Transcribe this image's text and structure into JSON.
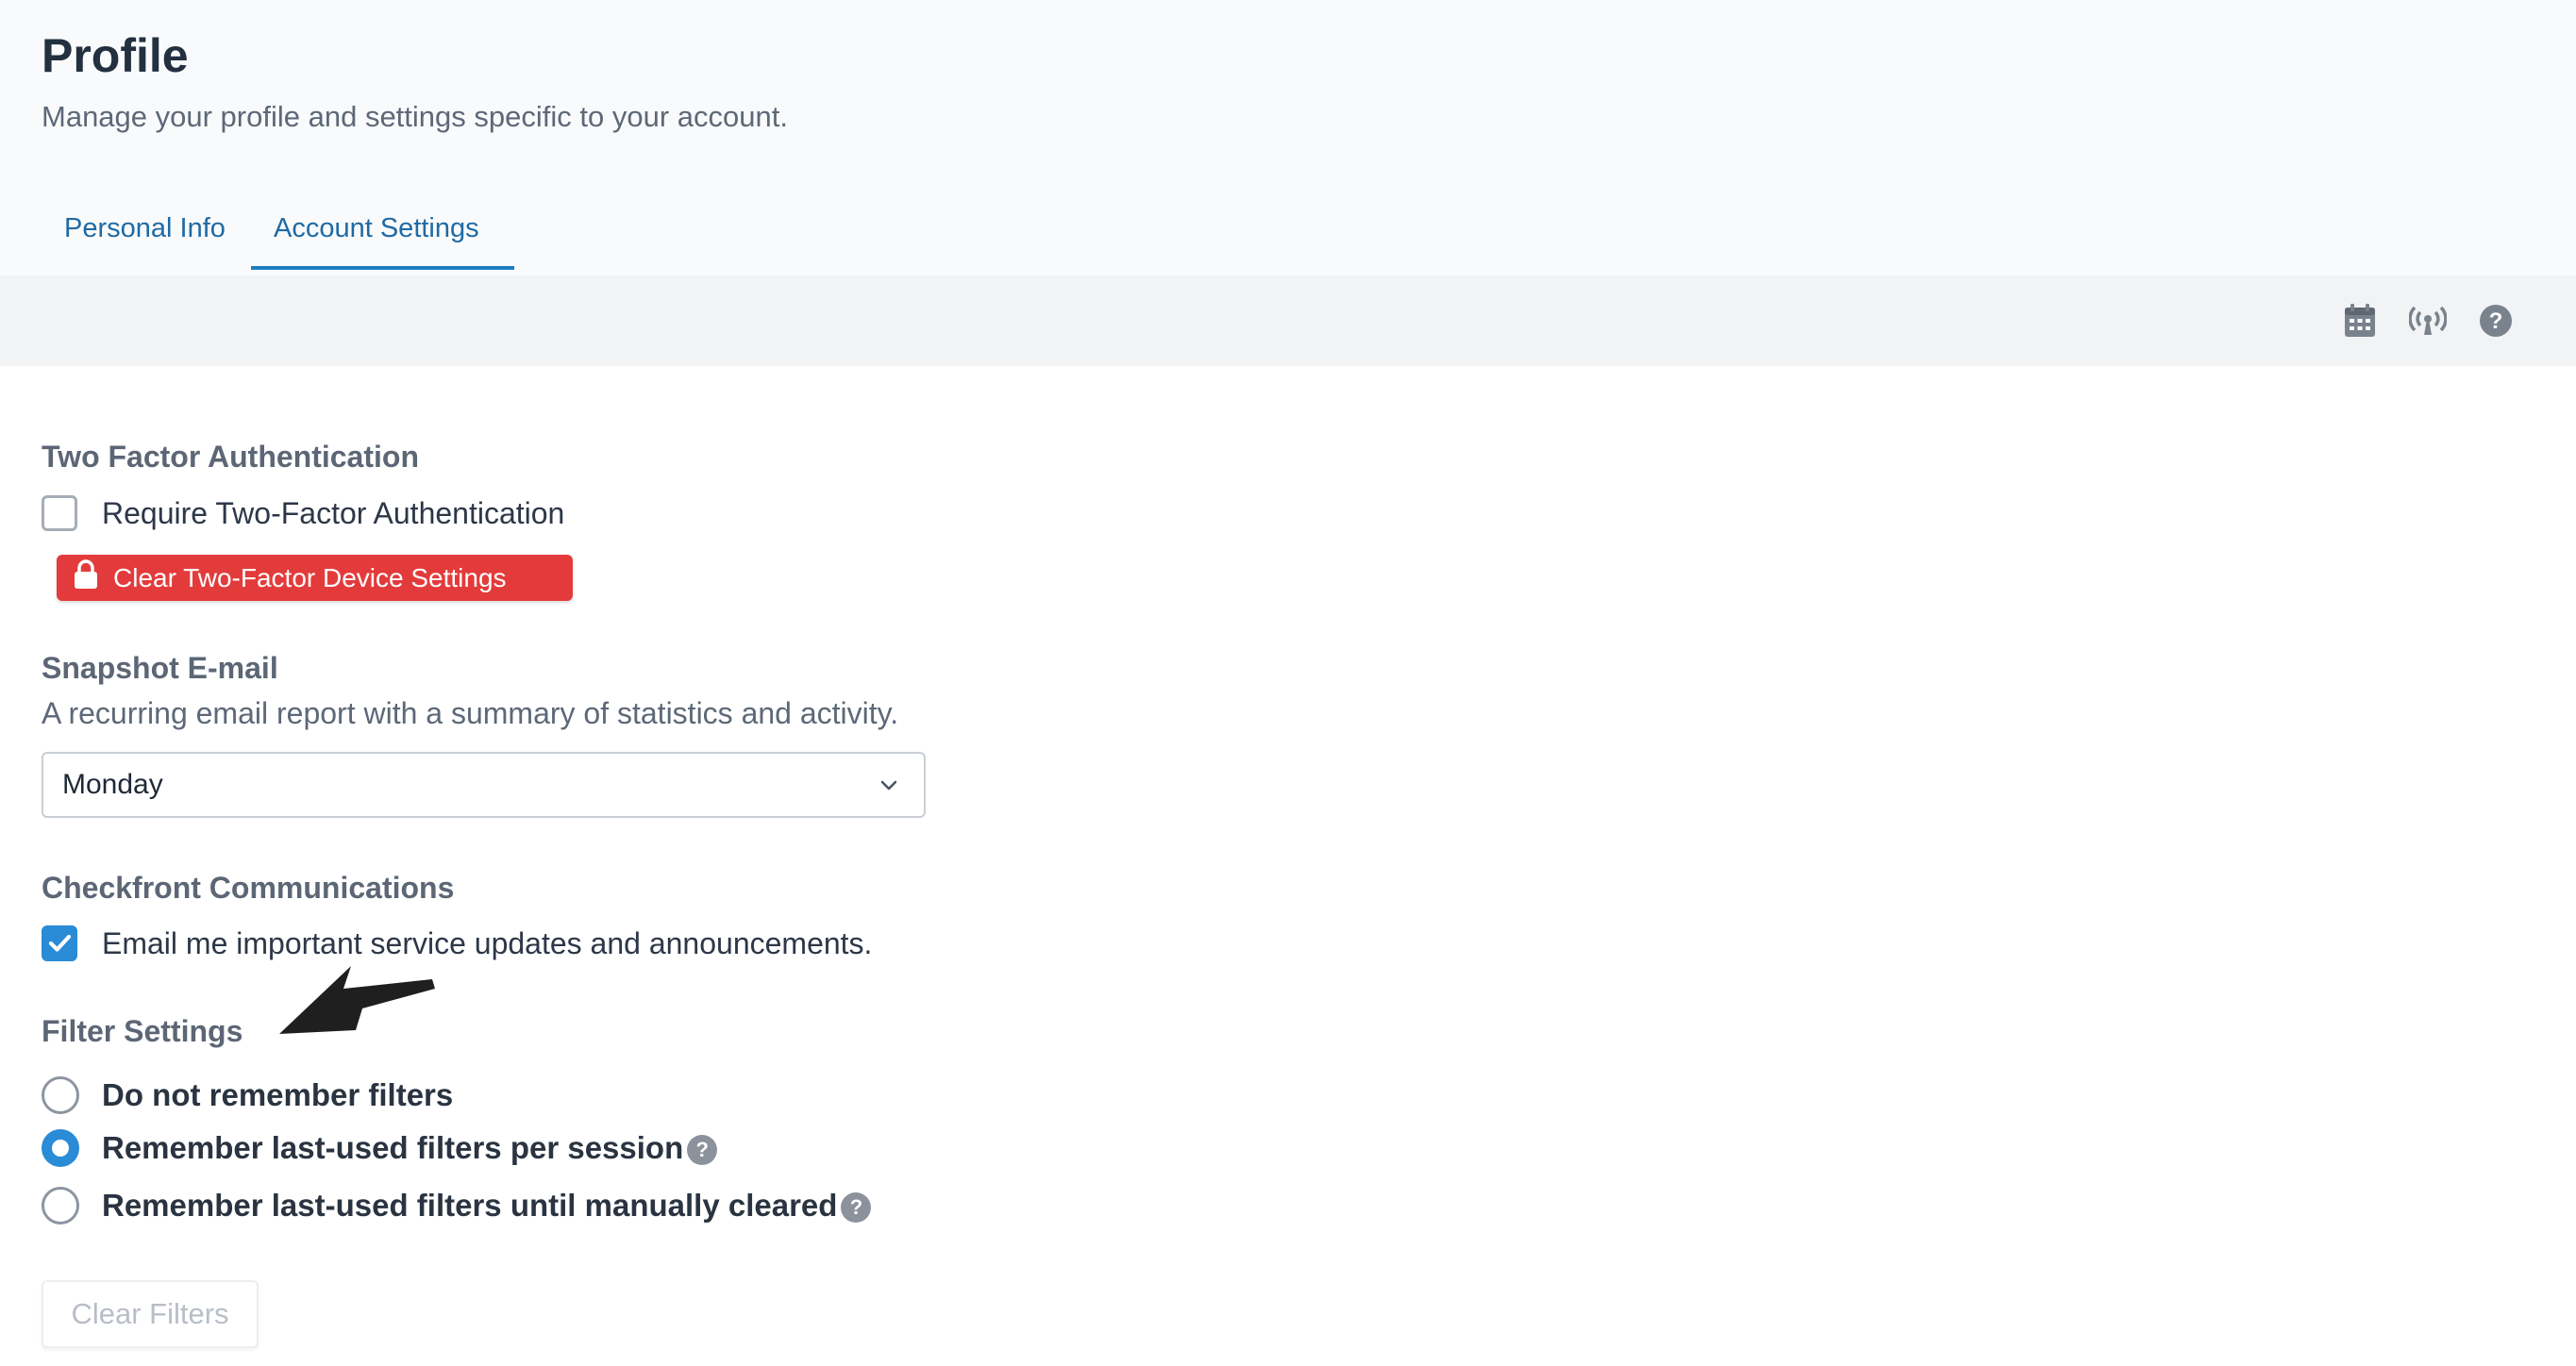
{
  "header": {
    "title": "Profile",
    "subtitle": "Manage your profile and settings specific to your account."
  },
  "tabs": [
    {
      "label": "Personal Info",
      "active": false
    },
    {
      "label": "Account Settings",
      "active": true
    }
  ],
  "toolbar": {
    "icons": [
      "calendar-icon",
      "broadcast-icon",
      "help-icon"
    ]
  },
  "two_factor": {
    "heading": "Two Factor Authentication",
    "require_label": "Require Two-Factor Authentication",
    "require_checked": false,
    "clear_button_label": "Clear Two-Factor Device Settings",
    "clear_button_icon": "lock-icon",
    "clear_button_color": "#e33b3b"
  },
  "snapshot": {
    "heading": "Snapshot E-mail",
    "description": "A recurring email report with a summary of statistics and activity.",
    "selected": "Monday"
  },
  "communications": {
    "heading": "Checkfront Communications",
    "email_label": "Email me important service updates and announcements.",
    "email_checked": true
  },
  "filters": {
    "heading": "Filter Settings",
    "options": [
      {
        "label": "Do not remember filters",
        "selected": false,
        "help": false
      },
      {
        "label": "Remember last-used filters per session",
        "selected": true,
        "help": true
      },
      {
        "label": "Remember last-used filters until manually cleared",
        "selected": false,
        "help": true
      }
    ],
    "help_glyph": "?",
    "clear_button_label": "Clear Filters"
  },
  "colors": {
    "accent": "#2a8bd6",
    "tab_text": "#1f6aa5",
    "danger": "#e33b3b"
  }
}
